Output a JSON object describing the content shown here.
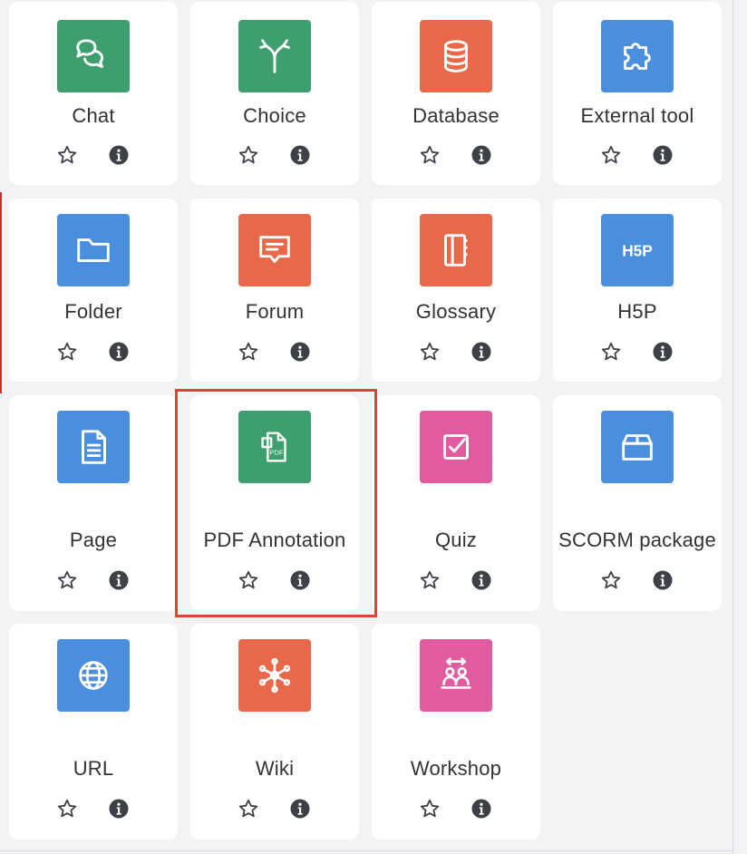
{
  "colors": {
    "green": "#3d9e6e",
    "orange": "#e8684a",
    "blue": "#4a8ede",
    "pink": "#e05c9e",
    "highlight": "#e0442d"
  },
  "tiles": [
    {
      "label": "Chat",
      "icon": "chat-icon",
      "color": "#3d9e6e",
      "star_icon": "star-outline-icon",
      "info_icon": "info-circle-icon"
    },
    {
      "label": "Choice",
      "icon": "choice-icon",
      "color": "#3d9e6e",
      "star_icon": "star-outline-icon",
      "info_icon": "info-circle-icon"
    },
    {
      "label": "Database",
      "icon": "database-icon",
      "color": "#e8684a",
      "star_icon": "star-outline-icon",
      "info_icon": "info-circle-icon"
    },
    {
      "label": "External tool",
      "icon": "puzzle-icon",
      "color": "#4a8ede",
      "star_icon": "star-outline-icon",
      "info_icon": "info-circle-icon"
    },
    {
      "label": "Folder",
      "icon": "folder-icon",
      "color": "#4a8ede",
      "star_icon": "star-outline-icon",
      "info_icon": "info-circle-icon"
    },
    {
      "label": "Forum",
      "icon": "forum-icon",
      "color": "#e8684a",
      "star_icon": "star-outline-icon",
      "info_icon": "info-circle-icon"
    },
    {
      "label": "Glossary",
      "icon": "glossary-icon",
      "color": "#e8684a",
      "star_icon": "star-outline-icon",
      "info_icon": "info-circle-icon"
    },
    {
      "label": "H5P",
      "icon": "h5p-icon",
      "color": "#4a8ede",
      "star_icon": "star-outline-icon",
      "info_icon": "info-circle-icon"
    },
    {
      "label": "Page",
      "icon": "page-icon",
      "color": "#4a8ede",
      "star_icon": "star-outline-icon",
      "info_icon": "info-circle-icon"
    },
    {
      "label": "PDF Annotation",
      "icon": "pdf-icon",
      "color": "#3d9e6e",
      "star_icon": "star-outline-icon",
      "info_icon": "info-circle-icon"
    },
    {
      "label": "Quiz",
      "icon": "quiz-icon",
      "color": "#e05c9e",
      "star_icon": "star-outline-icon",
      "info_icon": "info-circle-icon"
    },
    {
      "label": "SCORM package",
      "icon": "scorm-icon",
      "color": "#4a8ede",
      "star_icon": "star-outline-icon",
      "info_icon": "info-circle-icon"
    },
    {
      "label": "URL",
      "icon": "globe-icon",
      "color": "#4a8ede",
      "star_icon": "star-outline-icon",
      "info_icon": "info-circle-icon"
    },
    {
      "label": "Wiki",
      "icon": "wiki-icon",
      "color": "#e8684a",
      "star_icon": "star-outline-icon",
      "info_icon": "info-circle-icon"
    },
    {
      "label": "Workshop",
      "icon": "workshop-icon",
      "color": "#e05c9e",
      "star_icon": "star-outline-icon",
      "info_icon": "info-circle-icon"
    }
  ]
}
